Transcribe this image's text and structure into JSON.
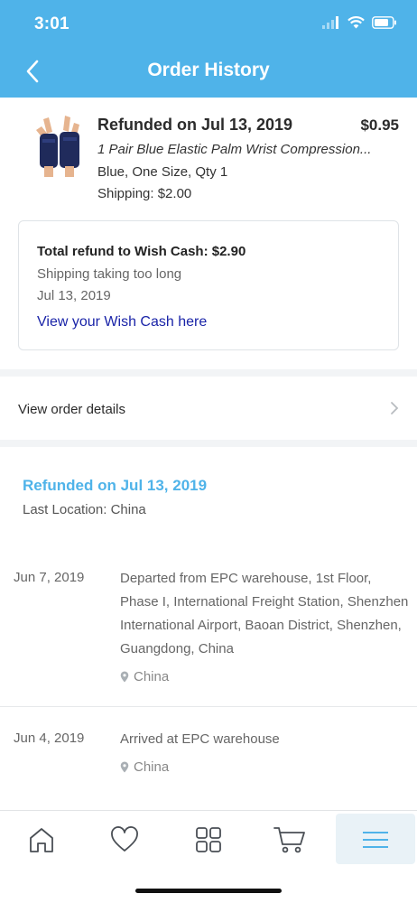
{
  "status_bar": {
    "time": "3:01"
  },
  "header": {
    "title": "Order History"
  },
  "product": {
    "status": "Refunded on Jul 13, 2019",
    "price": "$0.95",
    "name": "1 Pair Blue Elastic Palm Wrist Compression...",
    "variant": "Blue, One Size, Qty 1",
    "shipping": "Shipping: $2.00"
  },
  "refund_card": {
    "total": "Total refund to Wish Cash: $2.90",
    "reason": "Shipping taking too long",
    "date": "Jul 13, 2019",
    "link": "View your Wish Cash here"
  },
  "order_details": {
    "label": "View order details"
  },
  "tracking": {
    "status": "Refunded on Jul 13, 2019",
    "last_location": "Last Location: China",
    "events": [
      {
        "date": "Jun 7, 2019",
        "description": "Departed from EPC warehouse, 1st Floor, Phase I, International Freight Station, Shenzhen International Airport, Baoan District, Shenzhen, Guangdong, China",
        "place": "China"
      },
      {
        "date": "Jun 4, 2019",
        "description": "Arrived at EPC warehouse",
        "place": "China"
      }
    ]
  },
  "bottom_nav": {
    "items": [
      "home-icon",
      "heart-icon",
      "grid-icon",
      "cart-icon",
      "menu-icon"
    ],
    "active": "menu-icon"
  },
  "colors": {
    "header": "#4fb3e9",
    "link": "#1a24a8",
    "tracking_status": "#4fb3e9"
  }
}
